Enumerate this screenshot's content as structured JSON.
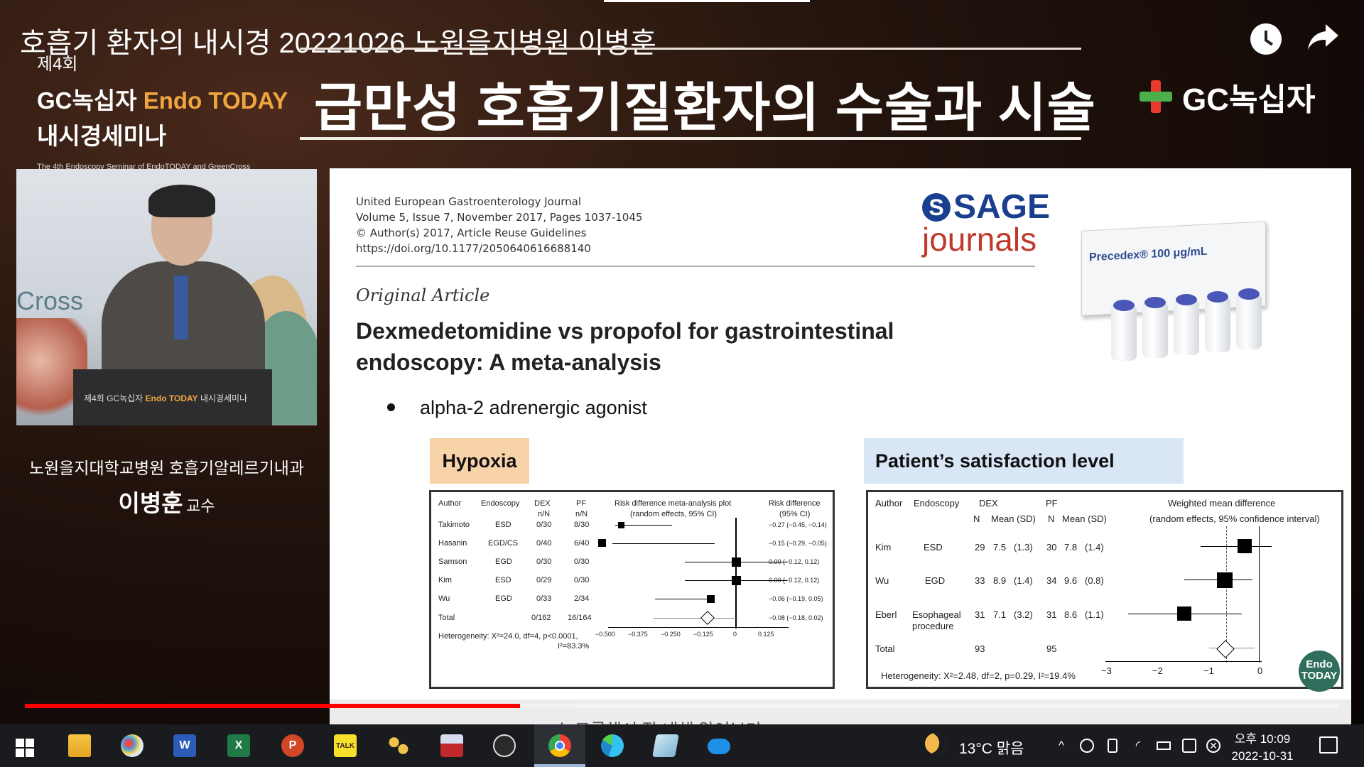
{
  "video": {
    "title": "호흡기 환자의 내시경 20221026 노원을지병원 이병훈",
    "progress_fraction": 0.377,
    "buffer_fraction": 0.418
  },
  "banner": {
    "seminar_number": "제4회",
    "seminar_name_prefix": "GC녹십자 ",
    "seminar_name_brand": "Endo TODAY",
    "seminar_subtitle": "내시경세미나",
    "seminar_english": "The 4th Endoscopy Seminar of EndoTODAY and GreenCross",
    "main_title": "급만성 호흡기질환자의 수술과 시술",
    "sponsor_logo": "GC녹십자"
  },
  "speaker": {
    "affiliation": "노원을지대학교병원 호흡기알레르기내과",
    "name": "이병훈",
    "title": "교수",
    "backdrop_text": "Cross",
    "podium_prefix": "제4회 GC녹십자 ",
    "podium_brand": "Endo TODAY",
    "podium_suffix": " 내시경세미나"
  },
  "slide": {
    "journal_lines": [
      "United European Gastroenterology Journal",
      "Volume 5, Issue 7, November 2017, Pages 1037-1045",
      "© Author(s) 2017, Article Reuse Guidelines",
      "https://doi.org/10.1177/2050640616688140"
    ],
    "publisher_top": "SAGE",
    "publisher_bottom": "journals",
    "article_type": "Original Article",
    "article_title_line1": "Dexmedetomidine vs propofol for gastrointestinal",
    "article_title_line2": "endoscopy: A meta-analysis",
    "bullet": "alpha-2 adrenergic agonist",
    "product_label": "Precedex® 100 μg/mL",
    "hypoxia_label": "Hypoxia",
    "satisfaction_label": "Patient’s satisfaction level",
    "badge_line1": "Endo",
    "badge_line2": "TODAY",
    "caption_peek": "소 모롱해서 잘 내해 알어보기"
  },
  "hypoxia_plot": {
    "headers": {
      "author": "Author",
      "endoscopy": "Endoscopy",
      "dex": "DEX",
      "dex_sub": "n/N",
      "pf": "PF",
      "pf_sub": "n/N",
      "plot": "Risk difference meta-analysis plot",
      "plot_sub": "(random effects, 95% CI)",
      "rd": "Risk difference",
      "rd_sub": "(95% CI)"
    },
    "rows": [
      {
        "author": "Takimoto",
        "endoscopy": "ESD",
        "dex": "0/30",
        "pf": "8/30",
        "rd": "−0.27 (−0.45, −0.14)",
        "est": -0.27,
        "lo": -0.45,
        "hi": -0.14
      },
      {
        "author": "Hasanin",
        "endoscopy": "EGD/CS",
        "dex": "0/40",
        "pf": "6/40",
        "rd": "−0.15 (−0.29, −0.05)",
        "est": -0.15,
        "lo": -0.29,
        "hi": -0.05
      },
      {
        "author": "Samson",
        "endoscopy": "EGD",
        "dex": "0/30",
        "pf": "0/30",
        "rd": "0.00 (−0.12, 0.12)",
        "est": 0.0,
        "lo": -0.12,
        "hi": 0.12
      },
      {
        "author": "Kim",
        "endoscopy": "ESD",
        "dex": "0/29",
        "pf": "0/30",
        "rd": "0.00 (−0.12, 0.12)",
        "est": 0.0,
        "lo": -0.12,
        "hi": 0.12
      },
      {
        "author": "Wu",
        "endoscopy": "EGD",
        "dex": "0/33",
        "pf": "2/34",
        "rd": "−0.06 (−0.19, 0.05)",
        "est": -0.06,
        "lo": -0.19,
        "hi": 0.05
      }
    ],
    "total": {
      "author": "Total",
      "dex": "0/162",
      "pf": "16/164",
      "rd": "−0.08 (−0.18, 0.02)"
    },
    "heterogeneity_line1": "Heterogeneity: X²=24.0, df=4, p<0.0001,",
    "heterogeneity_line2": "I²=83.3%",
    "axis_ticks": [
      "−0.500",
      "−0.375",
      "−0.250",
      "−0.125",
      "0",
      "0.125"
    ]
  },
  "satisfaction_plot": {
    "headers": {
      "author": "Author",
      "endoscopy": "Endoscopy",
      "dex": "DEX",
      "pf": "PF",
      "n1": "N",
      "mean1": "Mean (SD)",
      "n2": "N",
      "mean2": "Mean (SD)",
      "plot": "Weighted mean difference",
      "plot_sub": "(random effects, 95% confidence interval)"
    },
    "rows": [
      {
        "author": "Kim",
        "endoscopy": "ESD",
        "dex_n": "29",
        "dex_mean": "7.5",
        "dex_sd": "(1.3)",
        "pf_n": "30",
        "pf_mean": "7.8",
        "pf_sd": "(1.4)"
      },
      {
        "author": "Wu",
        "endoscopy": "EGD",
        "dex_n": "33",
        "dex_mean": "8.9",
        "dex_sd": "(1.4)",
        "pf_n": "34",
        "pf_mean": "9.6",
        "pf_sd": "(0.8)"
      },
      {
        "author": "Eberl",
        "endoscopy": "Esophageal",
        "endoscopy2": "procedure",
        "dex_n": "31",
        "dex_mean": "7.1",
        "dex_sd": "(3.2)",
        "pf_n": "31",
        "pf_mean": "8.6",
        "pf_sd": "(1.1)"
      }
    ],
    "total": {
      "author": "Total",
      "dex_n": "93",
      "pf_n": "95"
    },
    "heterogeneity": "Heterogeneity: X²=2.48, df=2, p=0.29, I²=19.4%",
    "axis_ticks": [
      "−3",
      "−2",
      "−1",
      "0"
    ]
  },
  "taskbar": {
    "apps": [
      "file-explorer",
      "paint",
      "word",
      "excel",
      "powerpoint",
      "kakaotalk",
      "people",
      "disk",
      "obs",
      "chrome",
      "edge",
      "notepad",
      "onedrive"
    ],
    "word_letter": "W",
    "excel_letter": "X",
    "ppt_letter": "P",
    "talk_letter": "TALK",
    "weather_temp": "13°C",
    "weather_desc": "맑음",
    "time": "오후 10:09",
    "date": "2022-10-31"
  },
  "colors": {
    "progress_played": "#ff0000",
    "hypoxia_label_bg": "#f8d2a8",
    "satisfaction_label_bg": "#d8e6f6",
    "brand_orange": "#f0a440",
    "sage_blue": "#1a3f8f"
  }
}
